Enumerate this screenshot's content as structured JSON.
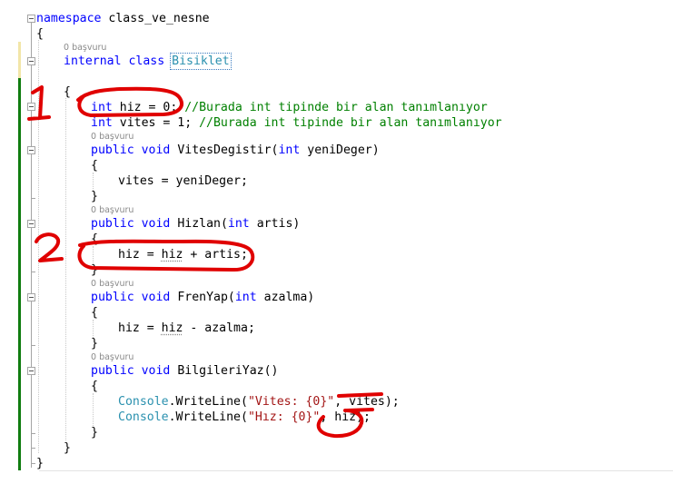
{
  "editor": {
    "reference_hint": "0 başvuru",
    "code": {
      "namespace_kw": "namespace",
      "namespace_name": "class_ve_nesne",
      "open_brace": "{",
      "close_brace": "}",
      "class_mod": "internal",
      "class_kw": "class",
      "class_name": "Bisiklet",
      "int_kw": "int",
      "hiz_decl_rest": " hiz = 0;",
      "hiz_comment": " //Burada int tipinde bir alan tanımlanıyor",
      "vites_decl_rest": " vites = 1;",
      "vites_comment": " //Burada int tipinde bir alan tanımlanıyor",
      "public_kw": "public",
      "void_kw": "void",
      "m1_name": "VitesDegistir",
      "m1_param": "yeniDeger",
      "m1_body_a": "vites = ",
      "m1_body_b": "yeniDeger",
      "m1_body_c": ";",
      "m2_name": "Hizlan",
      "m2_param": "artis",
      "m2_body_a": "hiz = ",
      "m2_body_b": "hiz",
      "m2_body_c": " + ",
      "m2_body_d": "artis",
      "m2_body_e": ";",
      "m3_name": "FrenYap",
      "m3_param": "azalma",
      "m3_body_a": "hiz = ",
      "m3_body_b": "hiz",
      "m3_body_c": " - ",
      "m3_body_d": "azalma",
      "m3_body_e": ";",
      "m4_name": "BilgileriYaz",
      "console": "Console",
      "writeline": "WriteLine",
      "str_vites": "\"Vites: {0}\"",
      "arg_vites": "vites",
      "str_hiz": "\"Hız: {0}\"",
      "arg_hiz": "hiz",
      "paren_open": "(",
      "paren_close": ")",
      "paren_empty": "()",
      "dot": ".",
      "comma": ", ",
      "end_call": ");",
      "int_space": "int "
    }
  },
  "annotations": {
    "marker_1": "1",
    "marker_2": "2",
    "color": "#e00000"
  },
  "colors": {
    "keyword": "#0000ff",
    "type": "#2b91af",
    "comment": "#008000",
    "string": "#a31515",
    "change_bar_saved": "#107c10",
    "change_bar_unsaved": "#f2e6a8"
  }
}
